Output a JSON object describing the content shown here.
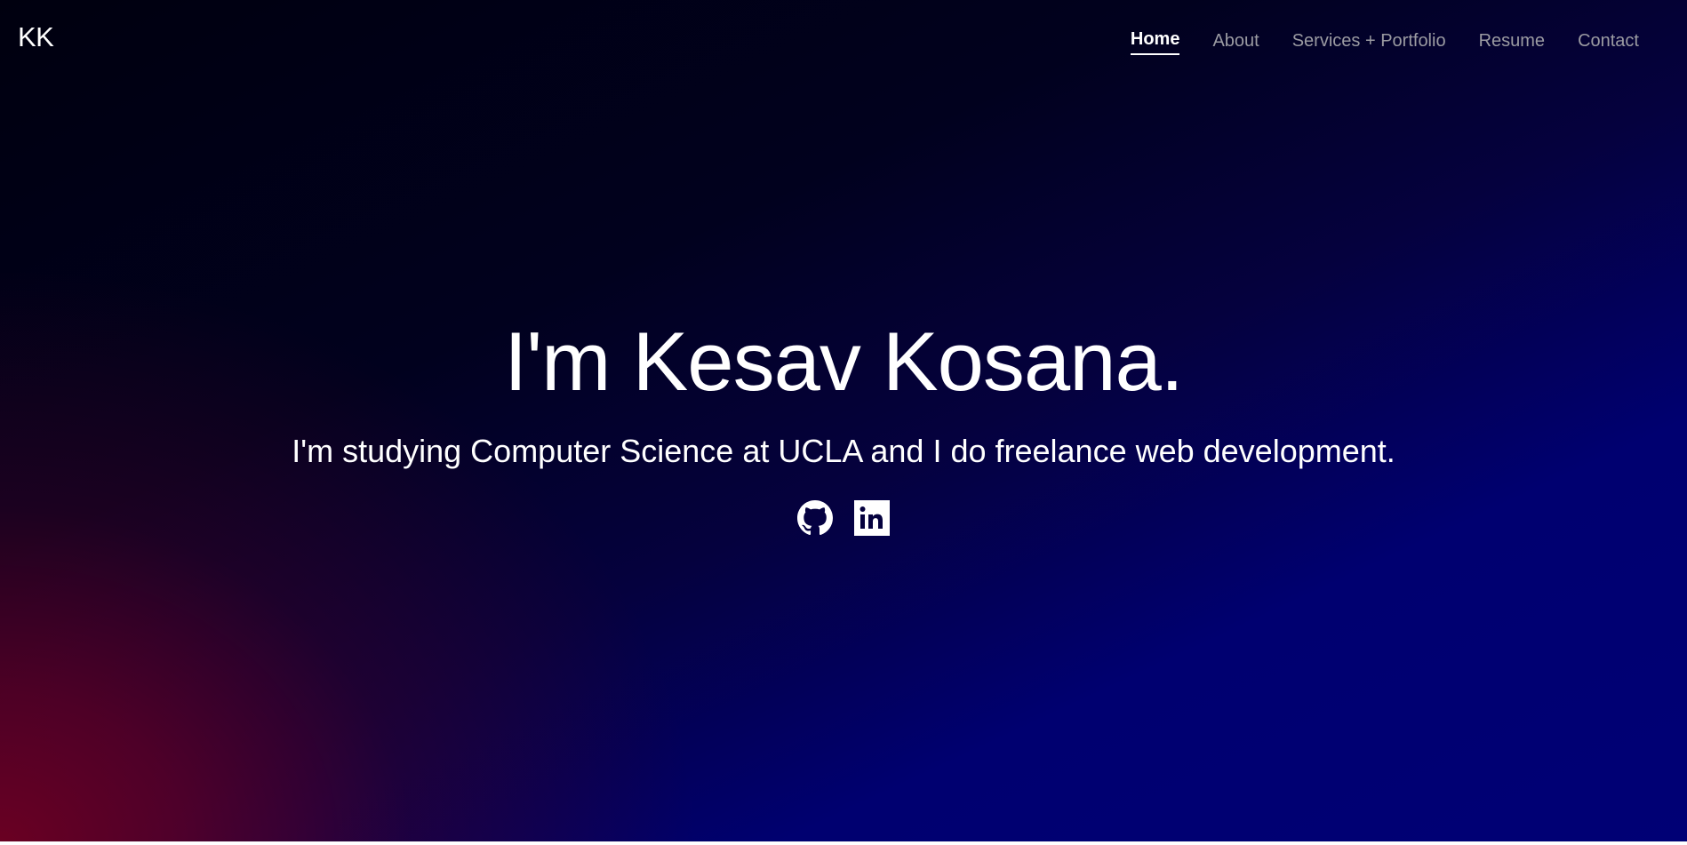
{
  "brand": {
    "label": "KK"
  },
  "nav": {
    "items": [
      {
        "label": "Home",
        "active": true
      },
      {
        "label": "About"
      },
      {
        "label": "Services + Portfolio"
      },
      {
        "label": "Resume"
      },
      {
        "label": "Contact"
      }
    ]
  },
  "hero": {
    "title": "I'm Kesav Kosana.",
    "subtitle": "I'm studying Computer Science at UCLA and I do freelance web development."
  },
  "social_links": [
    {
      "icon": "github-icon"
    },
    {
      "icon": "linkedin-icon"
    }
  ],
  "colors": {
    "text_primary": "#ffffff",
    "nav_inactive": "#9b9ba2",
    "gradient_red": "#6a0022",
    "gradient_navy": "#000070",
    "gradient_black": "#00000f"
  }
}
